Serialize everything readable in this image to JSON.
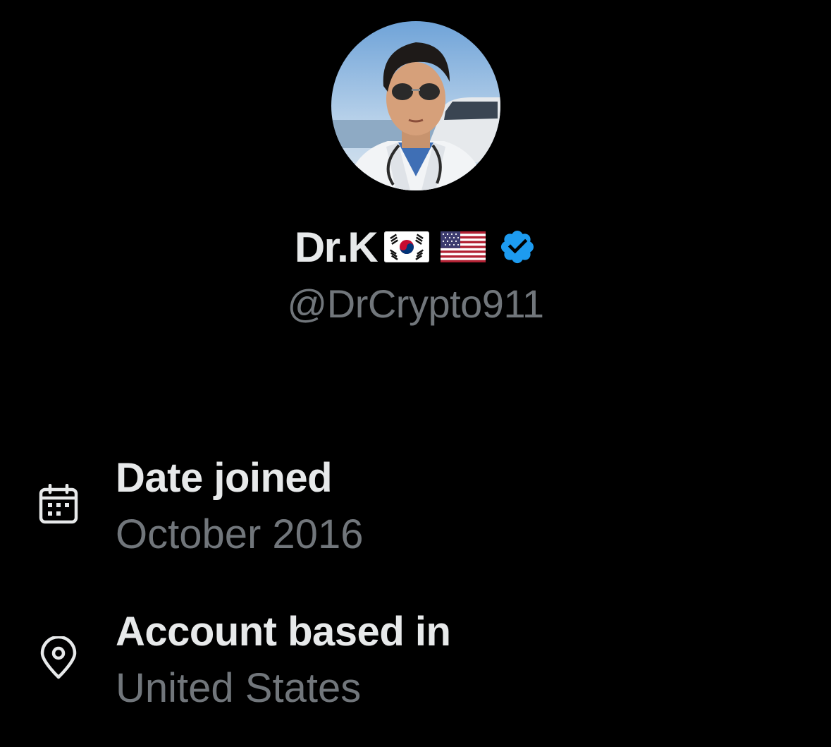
{
  "profile": {
    "avatar_icon": "profile-avatar-photo",
    "display_name": "Dr.K",
    "flags": [
      "south-korea-flag",
      "united-states-flag"
    ],
    "verified_icon": "verified-badge-icon",
    "verified_color": "#1d9bf0",
    "handle": "@DrCrypto911"
  },
  "about": {
    "items": [
      {
        "icon": "calendar-icon",
        "label": "Date joined",
        "value": "October 2016"
      },
      {
        "icon": "location-pin-icon",
        "label": "Account based in",
        "value": "United States"
      }
    ]
  },
  "colors": {
    "background": "#000000",
    "primary_text": "#e7e9ea",
    "secondary_text": "#71767b",
    "accent": "#1d9bf0"
  }
}
